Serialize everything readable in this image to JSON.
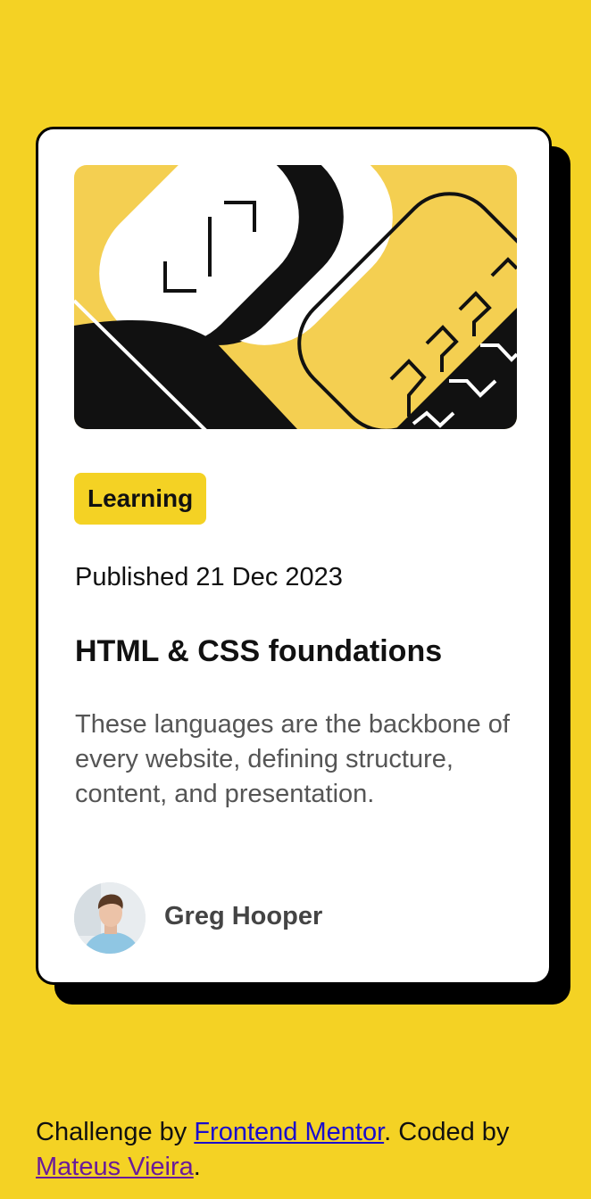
{
  "card": {
    "image_alt": "illustration",
    "tag": "Learning",
    "published": "Published 21 Dec 2023",
    "title": "HTML & CSS foundations",
    "description": "These languages are the backbone of every website, defining structure, content, and presentation.",
    "author": "Greg Hooper"
  },
  "footer": {
    "prefix": "Challenge by ",
    "link1": "Frontend Mentor",
    "middle": ". Coded by ",
    "link2": "Mateus Vieira",
    "suffix": "."
  },
  "colors": {
    "background": "#f4d224",
    "card": "#ffffff",
    "ink": "#111111",
    "illustration_bg": "#f4cf51"
  }
}
